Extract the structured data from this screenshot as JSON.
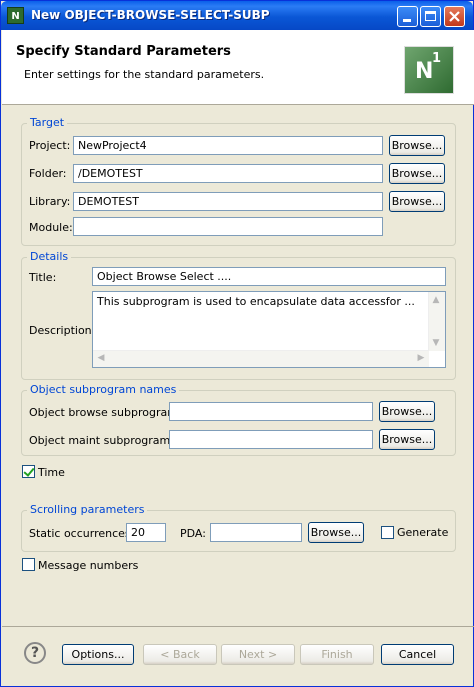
{
  "window": {
    "title": "New OBJECT-BROWSE-SELECT-SUBP",
    "icon": "natural-n1-icon"
  },
  "header": {
    "title": "Specify Standard Parameters",
    "description": "Enter settings for the standard parameters.",
    "banner_letter": "N",
    "banner_sup": "1"
  },
  "target": {
    "legend": "Target",
    "project_label": "Project:",
    "project_value": "NewProject4",
    "folder_label": "Folder:",
    "folder_value": "/DEMOTEST",
    "library_label": "Library:",
    "library_value": "DEMOTEST",
    "module_label": "Module:",
    "module_value": "",
    "browse_label": "Browse..."
  },
  "details": {
    "legend": "Details",
    "title_label": "Title:",
    "title_value": "Object Browse Select ....",
    "description_label": "Description:",
    "description_value": "This subprogram is used to encapsulate data accessfor ..."
  },
  "subprograms": {
    "legend": "Object subprogram names",
    "browse_label": "Object browse subprogram:",
    "browse_value": "",
    "maint_label": "Object maint subprogram:",
    "maint_value": "",
    "browse_button": "Browse..."
  },
  "time": {
    "label": "Time",
    "checked": true
  },
  "scrolling": {
    "legend": "Scrolling parameters",
    "static_label": "Static occurrences:",
    "static_value": "20",
    "pda_label": "PDA:",
    "pda_value": "",
    "browse_button": "Browse...",
    "generate_label": "Generate",
    "generate_checked": false
  },
  "message_numbers": {
    "label": "Message numbers",
    "checked": false
  },
  "footer": {
    "help_glyph": "?",
    "options_label": "Options...",
    "back_label": "< Back",
    "next_label": "Next >",
    "finish_label": "Finish",
    "cancel_label": "Cancel"
  }
}
